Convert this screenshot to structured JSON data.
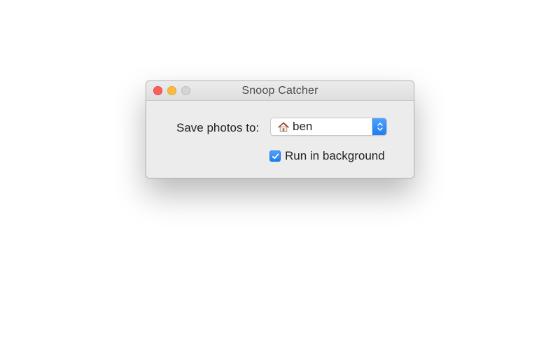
{
  "window": {
    "title": "Snoop Catcher",
    "controls": {
      "close": "close",
      "minimize": "minimize",
      "zoom": "zoom"
    }
  },
  "form": {
    "save_label": "Save photos to:",
    "destination": {
      "value": "ben",
      "icon": "home-icon"
    },
    "run_in_background": {
      "label": "Run in background",
      "checked": true
    }
  },
  "colors": {
    "accent": "#2a86f6",
    "close": "#fc605c",
    "minimize": "#fdbc40",
    "zoom": "#d5d5d5"
  }
}
